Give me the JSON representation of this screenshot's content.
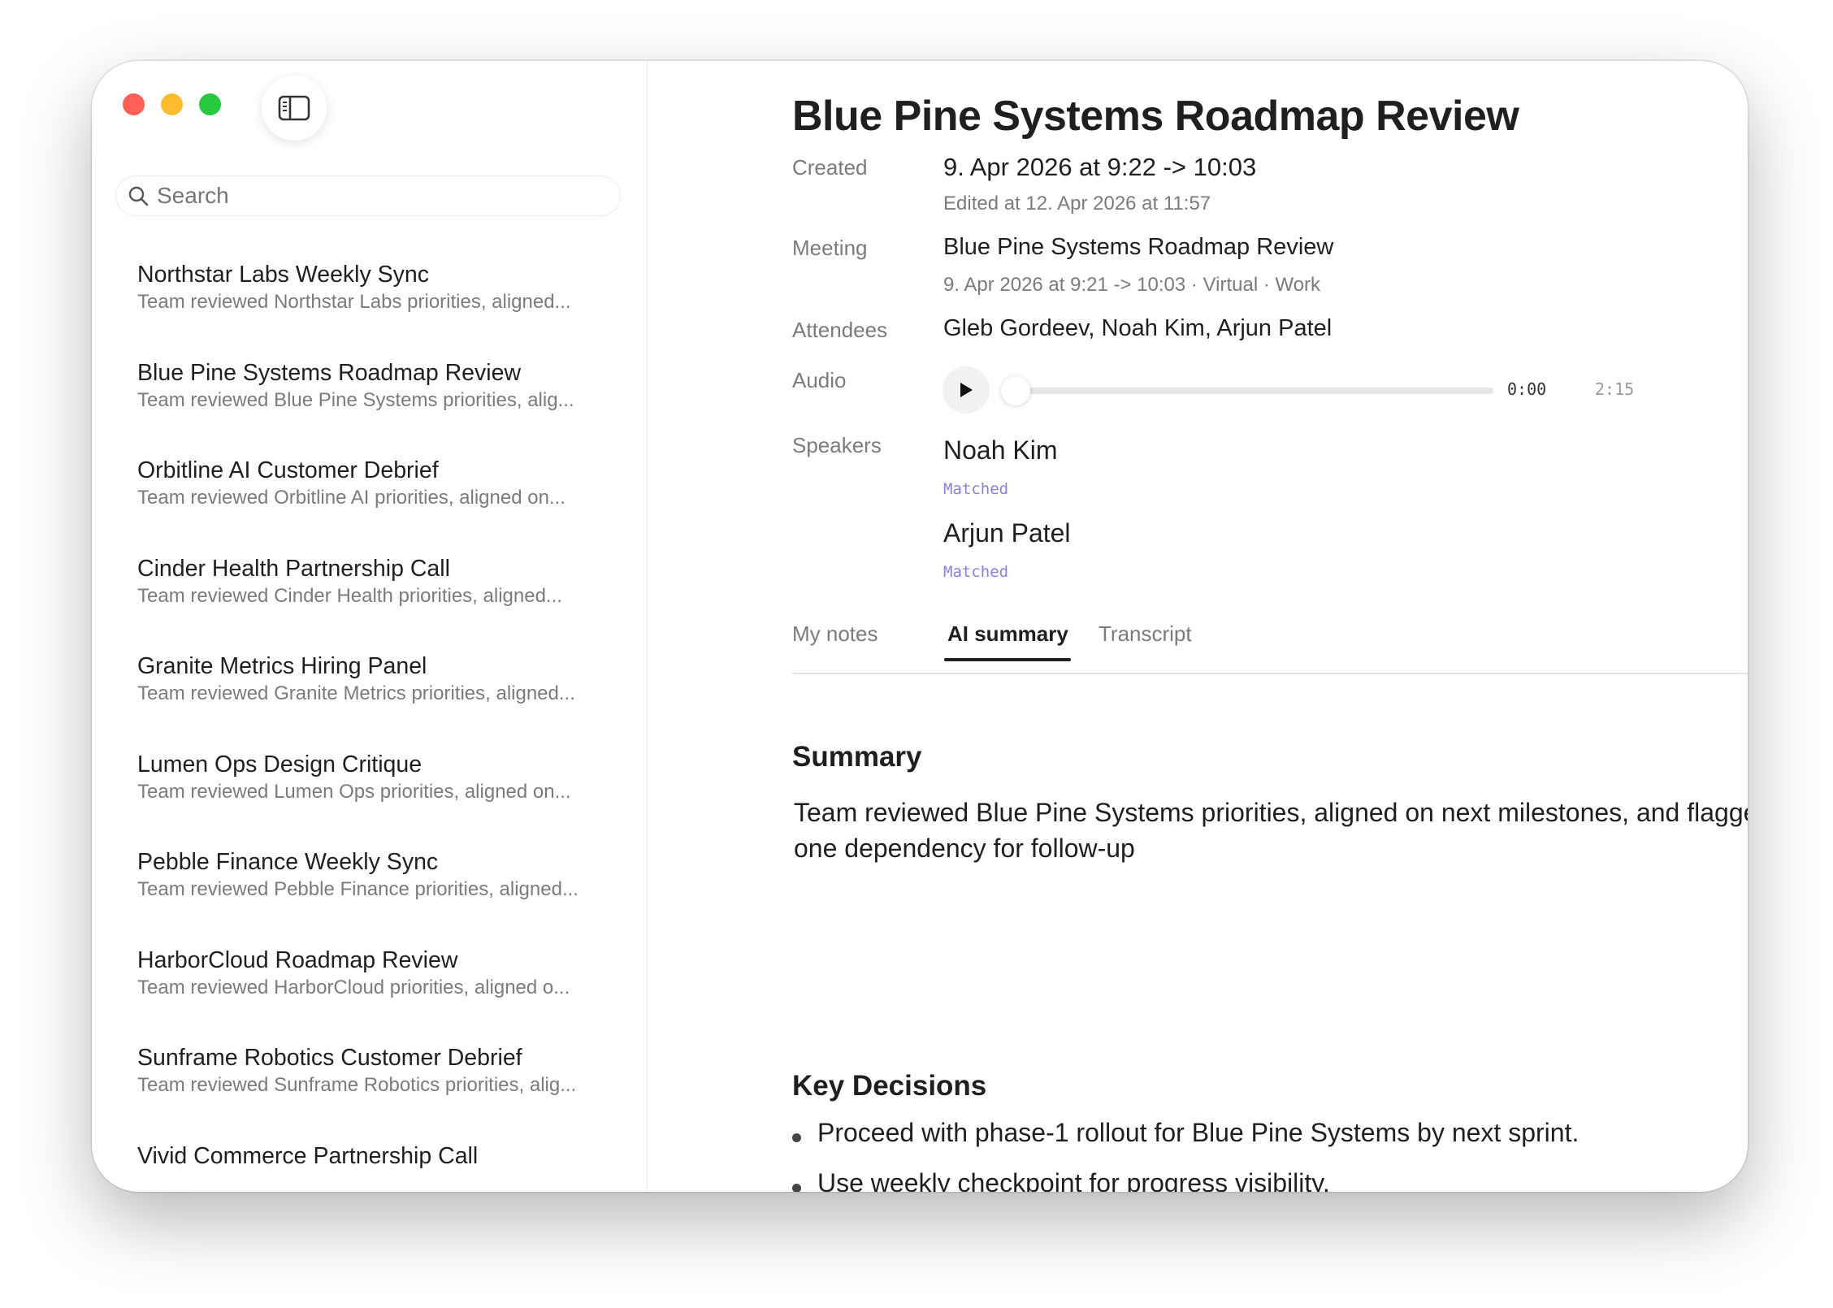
{
  "app": {
    "accent": "#8b7fe0"
  },
  "sidebar": {
    "search_placeholder": "Search",
    "items": [
      {
        "title": "Northstar Labs Weekly Sync",
        "preview": "Team reviewed Northstar Labs priorities, aligned..."
      },
      {
        "title": "Blue Pine Systems Roadmap Review",
        "preview": "Team reviewed Blue Pine Systems priorities, alig..."
      },
      {
        "title": "Orbitline AI Customer Debrief",
        "preview": "Team reviewed Orbitline AI priorities, aligned on..."
      },
      {
        "title": "Cinder Health Partnership Call",
        "preview": "Team reviewed Cinder Health priorities, aligned..."
      },
      {
        "title": "Granite Metrics Hiring Panel",
        "preview": "Team reviewed Granite Metrics priorities, aligned..."
      },
      {
        "title": "Lumen Ops Design Critique",
        "preview": "Team reviewed Lumen Ops priorities, aligned on..."
      },
      {
        "title": "Pebble Finance Weekly Sync",
        "preview": "Team reviewed Pebble Finance priorities, aligned..."
      },
      {
        "title": "HarborCloud Roadmap Review",
        "preview": "Team reviewed HarborCloud priorities, aligned o..."
      },
      {
        "title": "Sunframe Robotics Customer Debrief",
        "preview": "Team reviewed Sunframe Robotics priorities, alig..."
      },
      {
        "title": "Vivid Commerce Partnership Call",
        "preview": ""
      }
    ]
  },
  "main": {
    "title": "Blue Pine Systems Roadmap Review",
    "created": {
      "label": "Created",
      "value": "9. Apr 2026 at 9:22 -> 10:03",
      "edited": "Edited at 12. Apr 2026 at 11:57"
    },
    "meeting": {
      "label": "Meeting",
      "value": "Blue Pine Systems Roadmap Review",
      "details": "9. Apr 2026 at 9:21 -> 10:03 · Virtual · Work"
    },
    "attendees": {
      "label": "Attendees",
      "value": "Gleb Gordeev, Noah Kim, Arjun Patel"
    },
    "audio": {
      "label": "Audio",
      "current_time": "0:00",
      "duration": "2:15",
      "progress": 0
    },
    "speakers": {
      "label": "Speakers",
      "items": [
        {
          "name": "Noah Kim",
          "status": "Matched"
        },
        {
          "name": "Arjun Patel",
          "status": "Matched"
        }
      ]
    },
    "tabs": [
      {
        "label": "My notes"
      },
      {
        "label": "AI summary",
        "active": true
      },
      {
        "label": "Transcript"
      }
    ],
    "summary": {
      "heading": "Summary",
      "text": "Team reviewed Blue Pine Systems priorities, aligned on next milestones, and flagged one dependency for follow-up"
    },
    "key_decisions": {
      "heading": "Key Decisions",
      "items": [
        "Proceed with phase-1 rollout for Blue Pine Systems by next sprint.",
        "Use weekly checkpoint for progress visibility."
      ]
    }
  }
}
